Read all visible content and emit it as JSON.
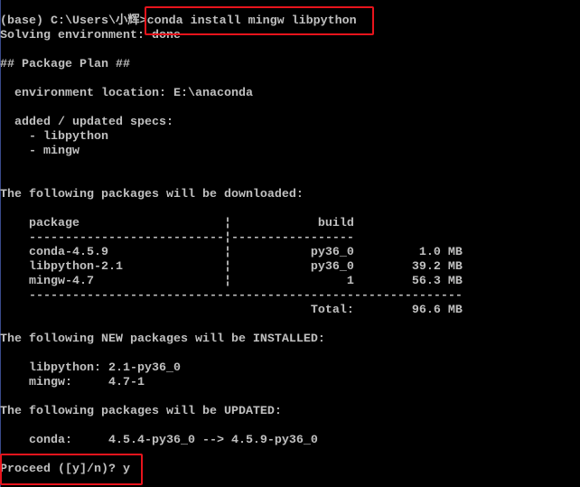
{
  "terminal": {
    "lines": [
      "(base) C:\\Users\\小辉>conda install mingw libpython",
      "Solving environment: done",
      "",
      "## Package Plan ##",
      "",
      "  environment location: E:\\anaconda",
      "",
      "  added / updated specs:",
      "    - libpython",
      "    - mingw",
      "",
      "",
      "The following packages will be downloaded:",
      "",
      "    package                    ¦            build",
      "    ---------------------------¦-----------------",
      "    conda-4.5.9                ¦           py36_0         1.0 MB",
      "    libpython-2.1              ¦           py36_0        39.2 MB",
      "    mingw-4.7                  ¦                1        56.3 MB",
      "    ------------------------------------------------------------",
      "                                           Total:        96.6 MB",
      "",
      "The following NEW packages will be INSTALLED:",
      "",
      "    libpython: 2.1-py36_0",
      "    mingw:     4.7-1",
      "",
      "The following packages will be UPDATED:",
      "",
      "    conda:     4.5.4-py36_0 --> 4.5.9-py36_0",
      "",
      "Proceed ([y]/n)? y"
    ]
  },
  "colors": {
    "background": "#000000",
    "text": "#c0c0c0",
    "highlight": "#e8141c"
  }
}
